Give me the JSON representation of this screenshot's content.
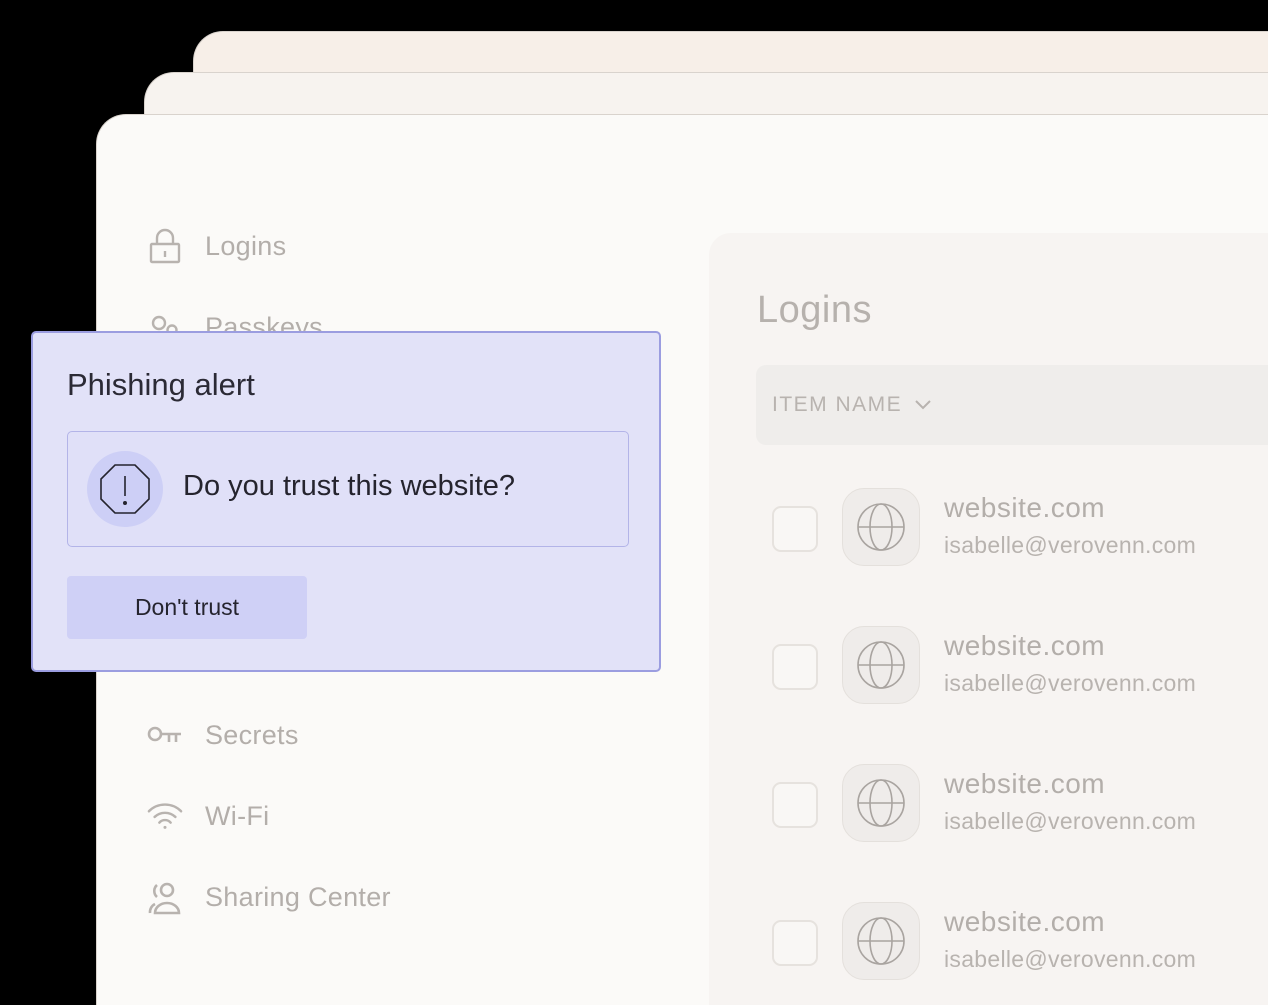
{
  "sidebar": {
    "items": [
      {
        "label": "Logins",
        "icon": "lock-icon"
      },
      {
        "label": "Passkeys",
        "icon": "passkey-icon"
      },
      {
        "label": "Secrets",
        "icon": "key-icon"
      },
      {
        "label": "Wi-Fi",
        "icon": "wifi-icon"
      },
      {
        "label": "Sharing Center",
        "icon": "sharing-center-icon"
      }
    ]
  },
  "panel": {
    "title": "Logins",
    "column_header": "ITEM NAME",
    "rows": [
      {
        "site": "website.com",
        "user": "isabelle@verovenn.com"
      },
      {
        "site": "website.com",
        "user": "isabelle@verovenn.com"
      },
      {
        "site": "website.com",
        "user": "isabelle@verovenn.com"
      },
      {
        "site": "website.com",
        "user": "isabelle@verovenn.com"
      }
    ]
  },
  "alert": {
    "title": "Phishing alert",
    "question": "Do you trust this website?",
    "button_label": "Don't trust",
    "icon": "warning-octagon-icon"
  },
  "colors": {
    "background": "#000000",
    "window": "#fbfaf8",
    "alert_fill": "#e2e2f8",
    "alert_border": "#9b9de0",
    "button_fill": "#cfd0f6",
    "muted_text": "#b3aeaa"
  }
}
